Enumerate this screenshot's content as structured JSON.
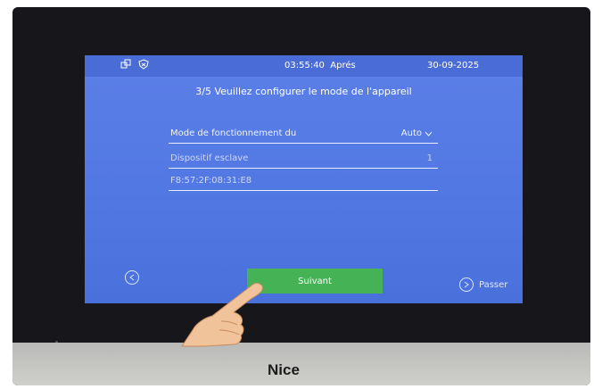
{
  "status_bar": {
    "time": "03:55:40",
    "time_suffix": "Aprés",
    "date": "30-09-2025",
    "icons": [
      "link-icon",
      "shield-icon"
    ]
  },
  "wizard": {
    "title": "3/5 Veuillez configurer le mode de l'appareil",
    "fields": [
      {
        "label": "Mode de fonctionnement du",
        "value": "Auto"
      },
      {
        "label": "Dispositif esclave",
        "value": "1"
      },
      {
        "label": "F8:57:2F:08:31:E8",
        "value": ""
      }
    ],
    "next_label": "Suivant",
    "skip_label": "Passer"
  },
  "device": {
    "brand": "Nice"
  },
  "colors": {
    "screen_bg": "#5177e3",
    "status_bg": "#4a6cd6",
    "button_green": "#45b355"
  }
}
